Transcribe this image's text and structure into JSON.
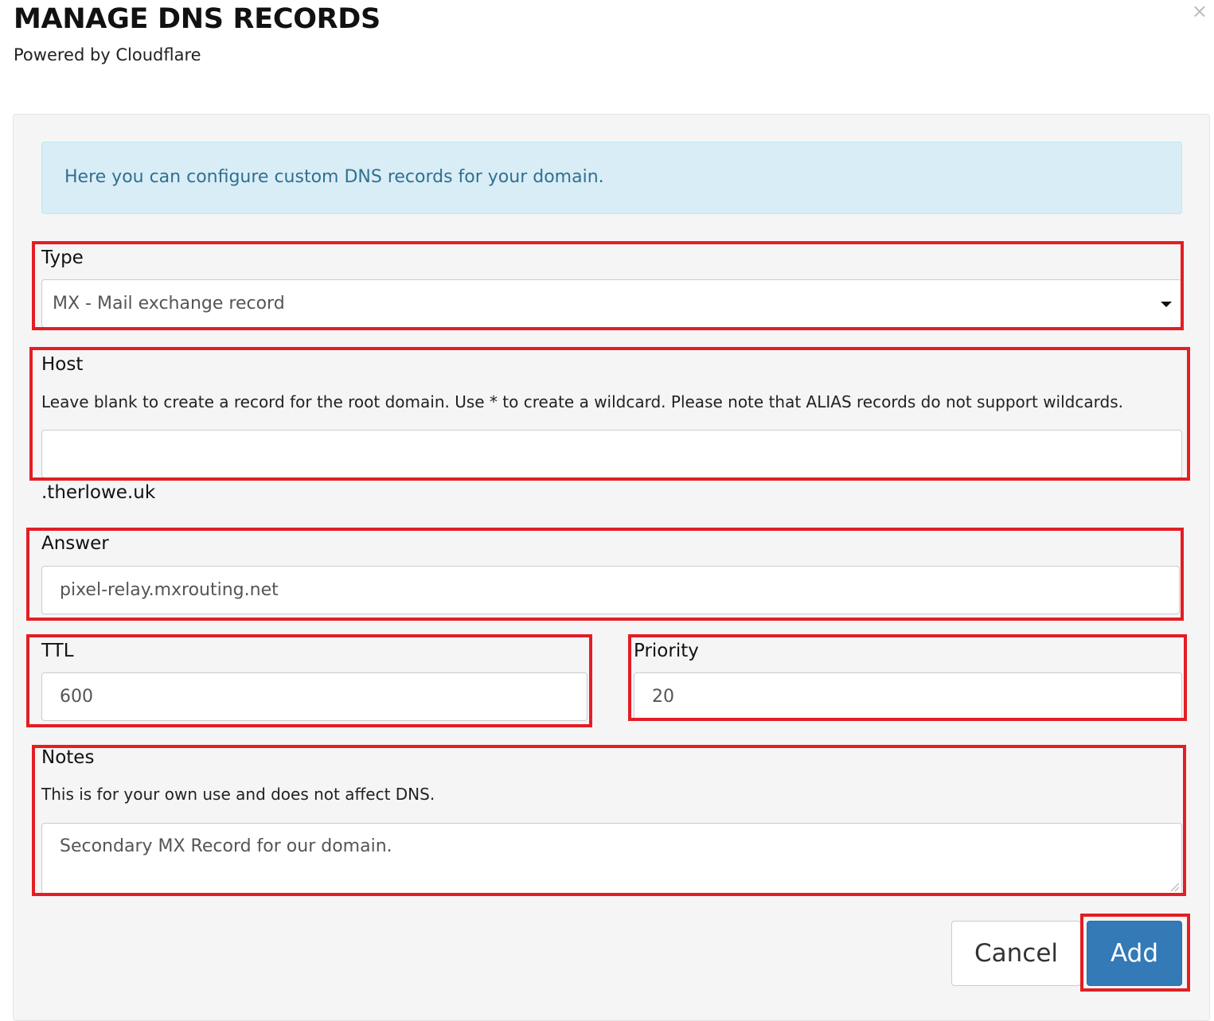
{
  "modal": {
    "title": "MANAGE DNS RECORDS",
    "subtitle": "Powered by Cloudflare",
    "close_glyph": "×",
    "info_text": "Here you can configure custom DNS records for your domain."
  },
  "form": {
    "type": {
      "label": "Type",
      "selected": "MX - Mail exchange record"
    },
    "host": {
      "label": "Host",
      "help": "Leave blank to create a record for the root domain. Use * to create a wildcard. Please note that ALIAS records do not support wildcards.",
      "value": "",
      "suffix": ".therlowe.uk"
    },
    "answer": {
      "label": "Answer",
      "value": "pixel-relay.mxrouting.net"
    },
    "ttl": {
      "label": "TTL",
      "value": "600"
    },
    "priority": {
      "label": "Priority",
      "value": "20"
    },
    "notes": {
      "label": "Notes",
      "help": "This is for your own use and does not affect DNS.",
      "value": "Secondary MX Record for our domain."
    }
  },
  "buttons": {
    "cancel": "Cancel",
    "add": "Add"
  },
  "colors": {
    "highlight": "#e31e24",
    "primary": "#337ab7",
    "info_bg": "#d9edf7",
    "info_text": "#31708f"
  },
  "icons": {
    "close": "close-icon",
    "dropdown": "caret-down-icon",
    "resize": "resize-grip-icon"
  }
}
